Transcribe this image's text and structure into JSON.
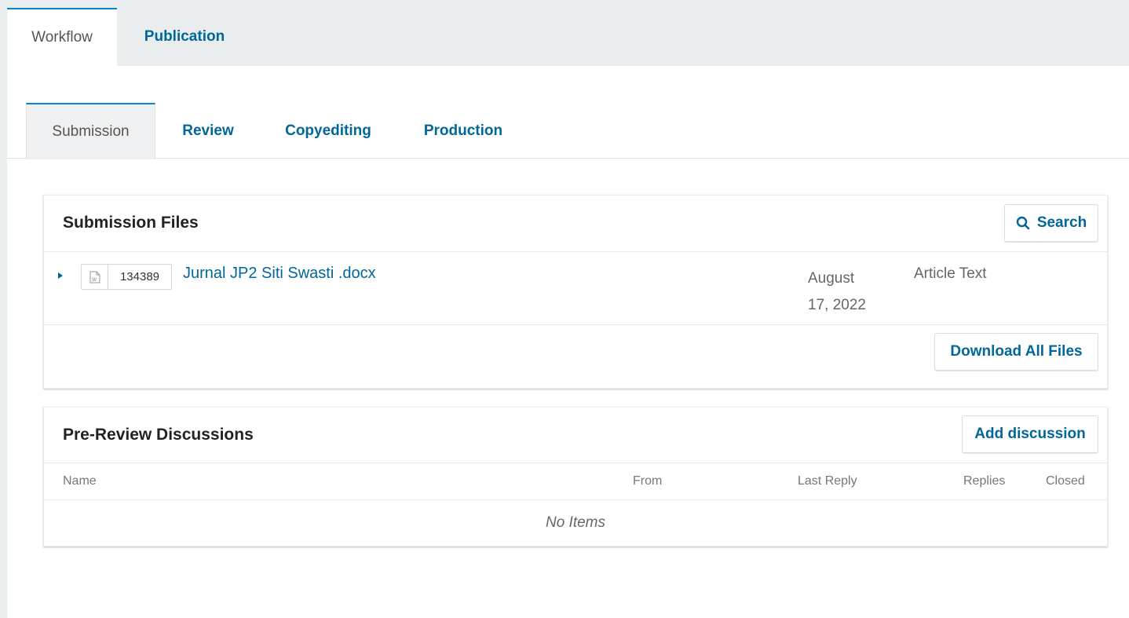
{
  "top_tabs": [
    {
      "label": "Workflow",
      "active": true
    },
    {
      "label": "Publication",
      "active": false
    }
  ],
  "stage_tabs": [
    {
      "label": "Submission",
      "active": true
    },
    {
      "label": "Review",
      "active": false
    },
    {
      "label": "Copyediting",
      "active": false
    },
    {
      "label": "Production",
      "active": false
    }
  ],
  "submission_files": {
    "title": "Submission Files",
    "search_label": "Search",
    "files": [
      {
        "id": "134389",
        "name": "Jurnal JP2 Siti Swasti .docx",
        "date_line1": "August",
        "date_line2": "17, 2022",
        "type": "Article Text",
        "icon": "word-document-icon"
      }
    ],
    "download_all_label": "Download All Files"
  },
  "discussions": {
    "title": "Pre-Review Discussions",
    "add_label": "Add discussion",
    "columns": {
      "name": "Name",
      "from": "From",
      "last_reply": "Last Reply",
      "replies": "Replies",
      "closed": "Closed"
    },
    "empty_text": "No Items"
  },
  "colors": {
    "link": "#006798",
    "tab_accent": "#008acb",
    "tab_bar_bg": "#eaedee"
  }
}
